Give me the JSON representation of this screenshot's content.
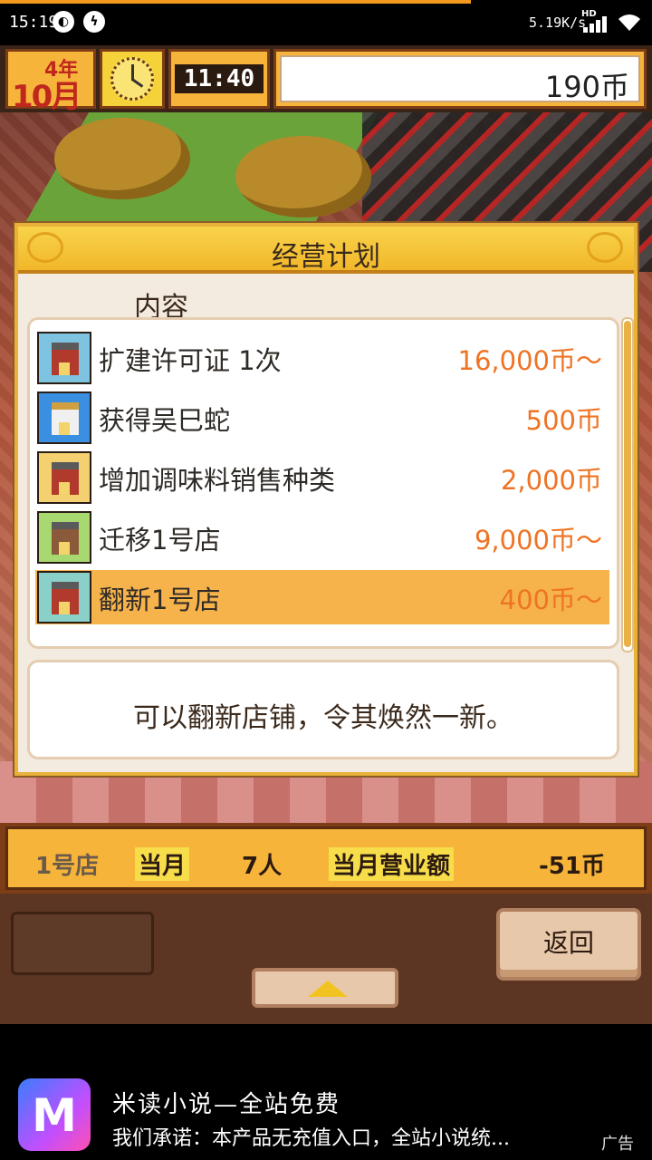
{
  "status_bar": {
    "time": "15:19",
    "network_speed": "5.19K/s",
    "network_type": "HD"
  },
  "hud": {
    "year_label": "4年",
    "month_label": "10月",
    "clock_time": "11:40",
    "money": "190币"
  },
  "dialog": {
    "title": "经营计划",
    "column_header": "内容",
    "items": [
      {
        "name": "扩建许可证 1次",
        "price": "16,000币～",
        "icon": "building-upgrade-icon",
        "selected": false
      },
      {
        "name": "获得吴巳蛇",
        "price": "500币",
        "icon": "mascot-icon",
        "selected": false
      },
      {
        "name": "增加调味料销售种类",
        "price": "2,000币",
        "icon": "shop-arrows-icon",
        "selected": false
      },
      {
        "name": "迁移1号店",
        "price": "9,000币～",
        "icon": "moving-truck-icon",
        "selected": false
      },
      {
        "name": "翻新1号店",
        "price": "400币～",
        "icon": "renovation-crane-icon",
        "selected": true
      }
    ],
    "description": "可以翻新店铺，令其焕然一新。"
  },
  "store_info": {
    "store": "1号店",
    "month": "当月",
    "people": "7人",
    "sales_label": "当月营业额",
    "sales_value": "-51币"
  },
  "controls": {
    "back_label": "返回"
  },
  "ad": {
    "app_title": "米读小说—全站免费",
    "subtitle": "我们承诺：本产品无充值入口，全站小说统...",
    "tag": "广告",
    "logo_letter": "M"
  },
  "colors": {
    "accent": "#f6b53a",
    "price": "#ee7424",
    "selected_row": "#f6b34c"
  }
}
